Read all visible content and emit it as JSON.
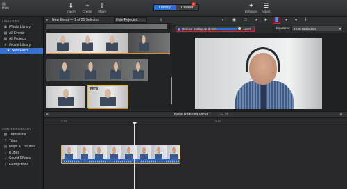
{
  "toolbar": {
    "hide": "Hide",
    "import": "Import",
    "create": "Create",
    "share": "Share",
    "tabs": [
      "Library",
      "Theater"
    ],
    "badge": "1",
    "enhance": "Enhance",
    "adjust": "Adjust"
  },
  "sidebar": {
    "libraries_heading": "LIBRARIES",
    "items": [
      {
        "label": "iPhoto Library",
        "icon": "photo-icon"
      },
      {
        "label": "All Events",
        "icon": "calendar-icon"
      },
      {
        "label": "All Projects",
        "icon": "film-icon"
      },
      {
        "label": "iMovie Library",
        "icon": "star-icon"
      },
      {
        "label": "New Event",
        "icon": "star-icon",
        "selected": true
      }
    ],
    "content_heading": "CONTENT LIBRARY",
    "content_items": [
      {
        "label": "Transitions",
        "icon": "transitions-icon"
      },
      {
        "label": "Titles",
        "icon": "titles-icon"
      },
      {
        "label": "Maps & ...rounds",
        "icon": "map-icon"
      },
      {
        "label": "iTunes",
        "icon": "music-icon"
      },
      {
        "label": "Sound Effects",
        "icon": "sound-icon"
      },
      {
        "label": "GarageBand",
        "icon": "guitar-icon"
      }
    ]
  },
  "browser": {
    "title": "New Event — 1 of 20 Selected",
    "filter": "Hide Rejected",
    "clip_time": "2.4s",
    "popup_title": "Noise Reduced Vocal"
  },
  "viewer_tools": {
    "noise_label": "Reduce background noise:",
    "noise_value_percent": 100,
    "noise_value": "100%",
    "equalizer_label": "Equalizer:",
    "equalizer_value": "Hum Reduction"
  },
  "timeline": {
    "title": "Noise Reduced Vocal",
    "duration": "— 2s",
    "ticks": [
      "0.0s",
      "5.0s"
    ]
  },
  "colors": {
    "accent": "#2c6fd8",
    "highlight_red": "#d8202b",
    "clip_yellow": "#e7b22a"
  }
}
